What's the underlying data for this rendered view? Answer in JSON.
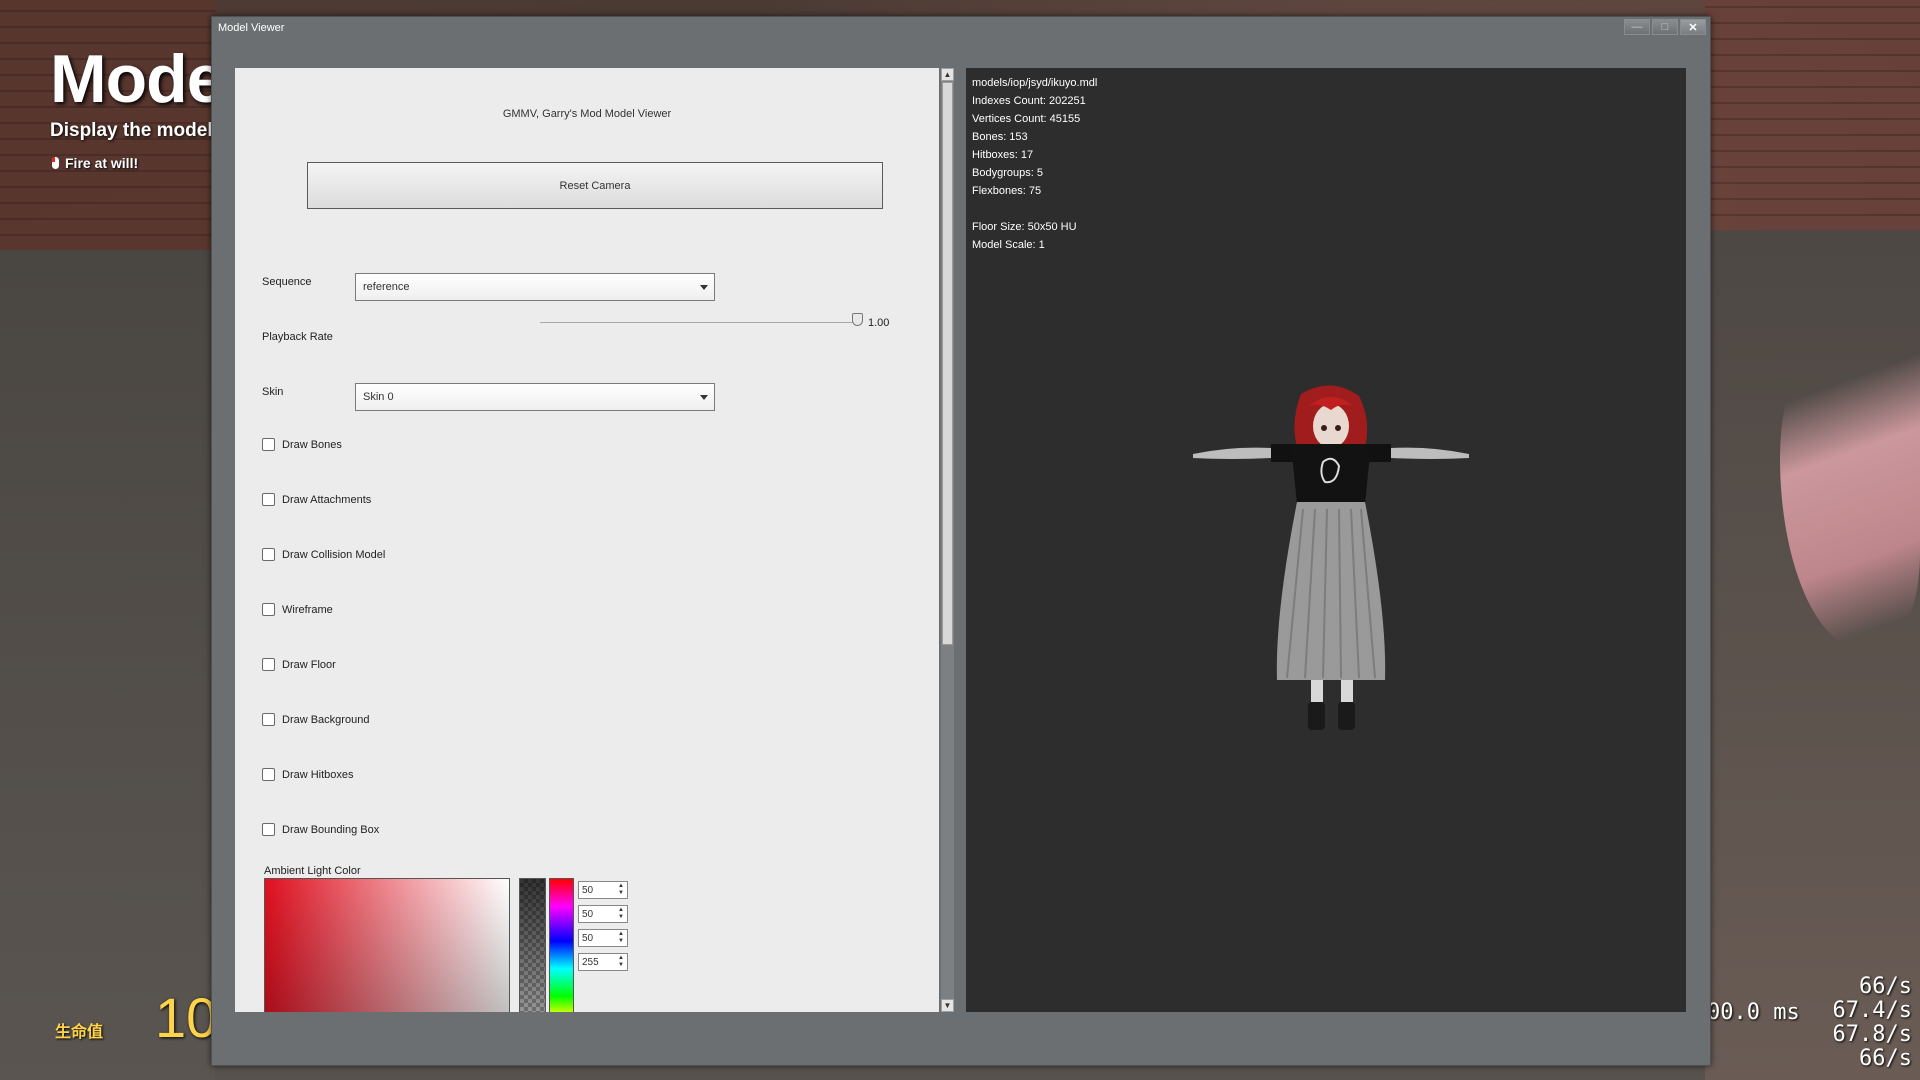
{
  "hud": {
    "title": "Mode",
    "subtitle": "Display the model",
    "fire_hint": "Fire at will!",
    "health_label": "生命值",
    "health_value": "10",
    "net_ms": "00.0 ms",
    "net_lines": [
      "66/s",
      "67.4/s",
      "67.8/s",
      "66/s"
    ]
  },
  "window": {
    "title": "Model Viewer",
    "buttons": {
      "minimize": "—",
      "maximize": "□",
      "close": "✕"
    }
  },
  "panel": {
    "header": "GMMV, Garry's Mod Model Viewer",
    "reset_camera": "Reset Camera",
    "sequence": {
      "label": "Sequence",
      "value": "reference"
    },
    "playback_rate": {
      "label": "Playback Rate",
      "value": "1.00",
      "fraction": 0.97
    },
    "skin": {
      "label": "Skin",
      "value": "Skin 0"
    },
    "checkboxes": [
      {
        "label": "Draw Bones",
        "checked": false
      },
      {
        "label": "Draw Attachments",
        "checked": false
      },
      {
        "label": "Draw Collision Model",
        "checked": false
      },
      {
        "label": "Wireframe",
        "checked": false
      },
      {
        "label": "Draw Floor",
        "checked": false
      },
      {
        "label": "Draw Background",
        "checked": false
      },
      {
        "label": "Draw Hitboxes",
        "checked": false
      },
      {
        "label": "Draw Bounding Box",
        "checked": false
      }
    ],
    "ambient_light": {
      "label": "Ambient Light Color",
      "values": [
        "50",
        "50",
        "50",
        "255"
      ]
    }
  },
  "viewport": {
    "info_lines": [
      "models/iop/jsyd/ikuyo.mdl",
      "Indexes Count: 202251",
      "Vertices Count: 45155",
      "Bones: 153",
      "Hitboxes: 17",
      "Bodygroups: 5",
      "Flexbones: 75"
    ],
    "info_lines_2": [
      "Floor Size: 50x50 HU",
      "Model Scale: 1"
    ]
  }
}
